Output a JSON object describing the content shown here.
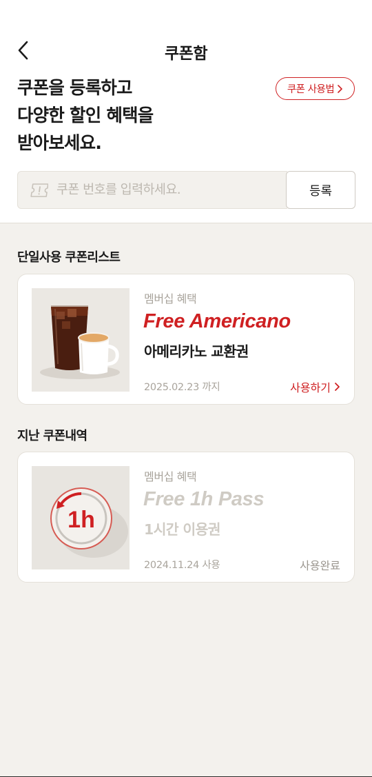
{
  "header": {
    "title": "쿠폰함"
  },
  "intro": {
    "line1": "쿠폰을 등록하고",
    "line2": "다양한 할인 혜택을",
    "line3": "받아보세요.",
    "guide_label": "쿠폰 사용법"
  },
  "register": {
    "placeholder": "쿠폰 번호를 입력하세요.",
    "button_label": "등록"
  },
  "active_section": {
    "title": "단일사용 쿠폰리스트",
    "coupons": [
      {
        "category": "멤버십 혜택",
        "promo": "Free Americano",
        "name": "아메리카노 교환권",
        "date": "2025.02.23 까지",
        "action": "사용하기",
        "thumb_icon": "iced-and-hot-coffee-image"
      }
    ]
  },
  "history_section": {
    "title": "지난 쿠폰내역",
    "coupons": [
      {
        "category": "멤버십 혜택",
        "promo": "Free 1h Pass",
        "name": "1시간 이용권",
        "date": "2024.11.24 사용",
        "status": "사용완료",
        "thumb_text": "1h",
        "thumb_icon": "one-hour-timer-icon"
      }
    ]
  },
  "colors": {
    "accent": "#cf2022",
    "background": "#f3f1ed",
    "muted_text": "#a9a49c",
    "faded_text": "#cfcbc4"
  }
}
